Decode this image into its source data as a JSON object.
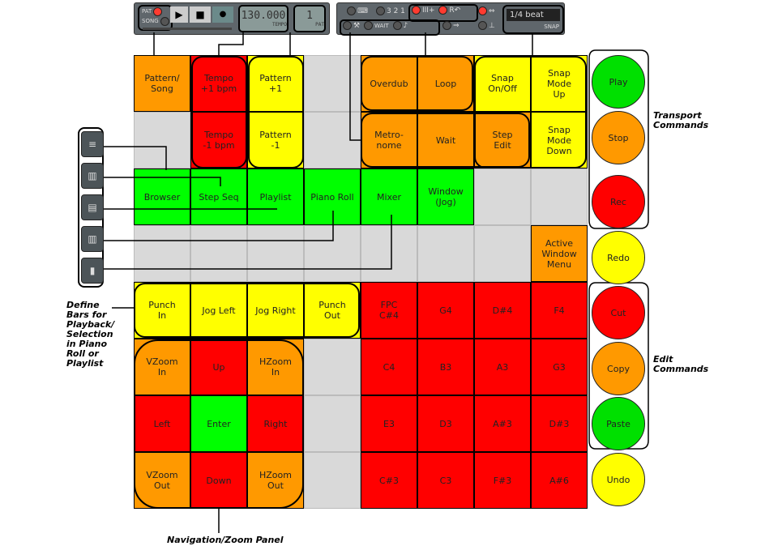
{
  "toolbar_left": {
    "pat": "PAT",
    "song": "SONG",
    "tempo_value": "130.000",
    "tempo_label": "TEMPO",
    "pattern_value": "1",
    "pattern_label": "PAT"
  },
  "toolbar_right": {
    "snap_value": "1/4 beat",
    "snap_label": "SNAP",
    "wait_label": "WAIT",
    "countdown": "3 2 1",
    "rec_label": "R"
  },
  "grid": [
    [
      {
        "t": "Pattern/\nSong",
        "c": "o"
      },
      {
        "t": "Tempo\n+1 bpm",
        "c": "r"
      },
      {
        "t": "Pattern\n+1",
        "c": "y"
      },
      {
        "t": "",
        "c": "gr"
      },
      {
        "t": "Overdub",
        "c": "o"
      },
      {
        "t": "Loop",
        "c": "o"
      },
      {
        "t": "Snap\nOn/Off",
        "c": "y"
      },
      {
        "t": "Snap\nMode\nUp",
        "c": "y"
      }
    ],
    [
      {
        "t": "",
        "c": "gr"
      },
      {
        "t": "Tempo\n-1 bpm",
        "c": "r"
      },
      {
        "t": "Pattern\n-1",
        "c": "y"
      },
      {
        "t": "",
        "c": "gr"
      },
      {
        "t": "Metro-\nnome",
        "c": "o"
      },
      {
        "t": "Wait",
        "c": "o"
      },
      {
        "t": "Step\nEdit",
        "c": "o"
      },
      {
        "t": "Snap\nMode\nDown",
        "c": "y"
      }
    ],
    [
      {
        "t": "Browser",
        "c": "g"
      },
      {
        "t": "Step Seq",
        "c": "g"
      },
      {
        "t": "Playlist",
        "c": "g"
      },
      {
        "t": "Piano Roll",
        "c": "g"
      },
      {
        "t": "Mixer",
        "c": "g"
      },
      {
        "t": "Window\n(Jog)",
        "c": "g"
      },
      {
        "t": "",
        "c": "gr"
      },
      {
        "t": "",
        "c": "gr"
      }
    ],
    [
      {
        "t": "",
        "c": "gr"
      },
      {
        "t": "",
        "c": "gr"
      },
      {
        "t": "",
        "c": "gr"
      },
      {
        "t": "",
        "c": "gr"
      },
      {
        "t": "",
        "c": "gr"
      },
      {
        "t": "",
        "c": "gr"
      },
      {
        "t": "",
        "c": "gr"
      },
      {
        "t": "Active\nWindow\nMenu",
        "c": "o"
      }
    ],
    [
      {
        "t": "Punch\nIn",
        "c": "y"
      },
      {
        "t": "Jog Left",
        "c": "y"
      },
      {
        "t": "Jog Right",
        "c": "y"
      },
      {
        "t": "Punch\nOut",
        "c": "y"
      },
      {
        "t": "FPC\nC#4",
        "c": "r"
      },
      {
        "t": "G4",
        "c": "r"
      },
      {
        "t": "D#4",
        "c": "r"
      },
      {
        "t": "F4",
        "c": "r"
      }
    ],
    [
      {
        "t": "VZoom\nIn",
        "c": "o"
      },
      {
        "t": "Up",
        "c": "r"
      },
      {
        "t": "HZoom\nIn",
        "c": "o"
      },
      {
        "t": "",
        "c": "gr"
      },
      {
        "t": "C4",
        "c": "r"
      },
      {
        "t": "B3",
        "c": "r"
      },
      {
        "t": "A3",
        "c": "r"
      },
      {
        "t": "G3",
        "c": "r"
      }
    ],
    [
      {
        "t": "Left",
        "c": "r"
      },
      {
        "t": "Enter",
        "c": "g"
      },
      {
        "t": "Right",
        "c": "r"
      },
      {
        "t": "",
        "c": "gr"
      },
      {
        "t": "E3",
        "c": "r"
      },
      {
        "t": "D3",
        "c": "r"
      },
      {
        "t": "A#3",
        "c": "r"
      },
      {
        "t": "D#3",
        "c": "r"
      }
    ],
    [
      {
        "t": "VZoom\nOut",
        "c": "o"
      },
      {
        "t": "Down",
        "c": "r"
      },
      {
        "t": "HZoom\nOut",
        "c": "o"
      },
      {
        "t": "",
        "c": "gr"
      },
      {
        "t": "C#3",
        "c": "r"
      },
      {
        "t": "C3",
        "c": "r"
      },
      {
        "t": "F#3",
        "c": "r"
      },
      {
        "t": "A#6",
        "c": "r"
      }
    ]
  ],
  "buttons": [
    {
      "t": "Play",
      "color": "#00e000"
    },
    {
      "t": "Stop",
      "color": "#ff9900"
    },
    {
      "t": "Rec",
      "color": "#ff0000"
    },
    {
      "t": "Redo",
      "color": "#ffff00"
    },
    {
      "t": "Cut",
      "color": "#ff0000"
    },
    {
      "t": "Copy",
      "color": "#ff9900"
    },
    {
      "t": "Paste",
      "color": "#00e000"
    },
    {
      "t": "Undo",
      "color": "#ffff00"
    }
  ],
  "labels": {
    "transport": "Transport\nCommands",
    "edit": "Edit\nCommands",
    "define": "Define\nBars for\nPlayback/\nSelection\nin Piano\nRoll or\nPlaylist",
    "nav": "Navigation/Zoom Panel"
  },
  "side_icons": [
    "browser-icon",
    "step-sequencer-icon",
    "playlist-icon",
    "piano-roll-icon",
    "mixer-icon"
  ]
}
